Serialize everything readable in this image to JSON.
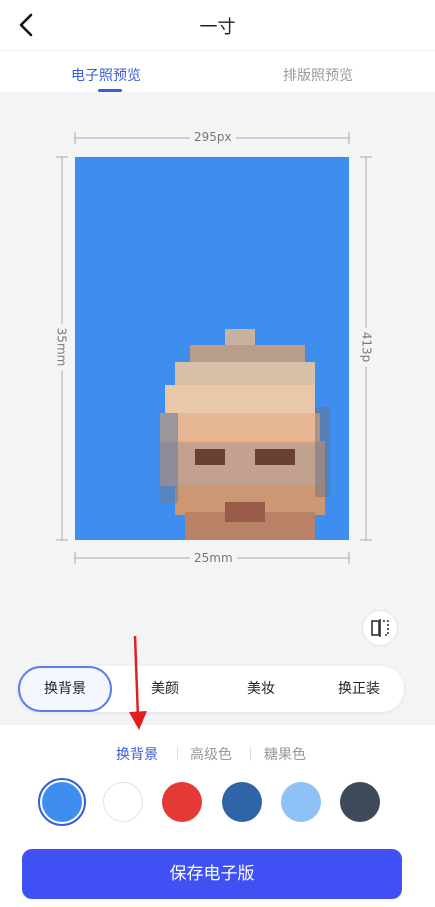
{
  "header": {
    "title": "一寸",
    "back_icon": "chevron-left-icon"
  },
  "tabs": [
    {
      "label": "电子照预览",
      "active": true
    },
    {
      "label": "排版照预览",
      "active": false
    }
  ],
  "preview": {
    "width_label": "295px",
    "height_label": "35mm",
    "right_label": "413p",
    "bottom_label": "25mm",
    "background_color": "#3e8eef"
  },
  "functions": [
    {
      "label": "换背景",
      "active": true
    },
    {
      "label": "美颜",
      "active": false
    },
    {
      "label": "美妆",
      "active": false
    },
    {
      "label": "换正装",
      "active": false
    }
  ],
  "sub_tabs": [
    {
      "label": "换背景",
      "active": true
    },
    {
      "label": "高级色",
      "active": false
    },
    {
      "label": "糖果色",
      "active": false
    }
  ],
  "colors": [
    "#3e8eef",
    "#ffffff",
    "#e53935",
    "#2f64a8",
    "#8ec1f5",
    "#3d4a5a"
  ],
  "selected_color_index": 0,
  "save_button": {
    "label": "保存电子版"
  },
  "annotation": {
    "arrow_color": "#e02020"
  }
}
